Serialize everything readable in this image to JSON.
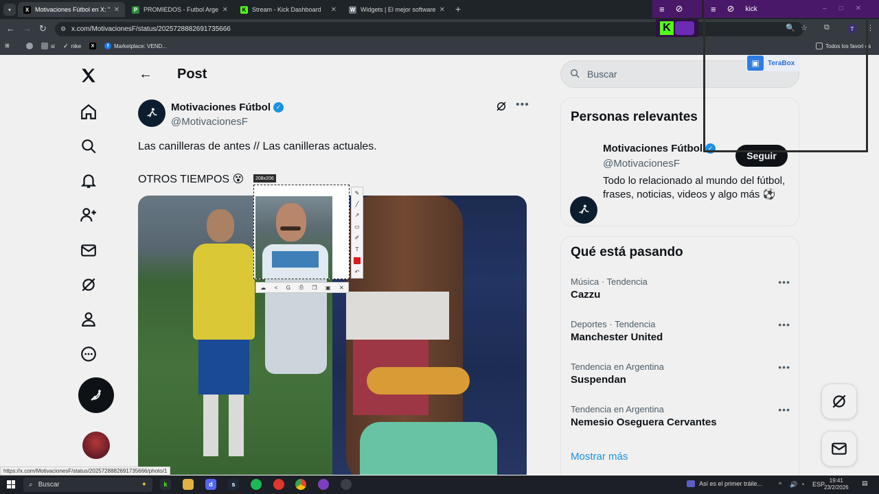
{
  "browser": {
    "tabs": [
      {
        "title": "Motivaciones Fútbol en X: \"Las",
        "favicon": "X",
        "active": true
      },
      {
        "title": "PROMIEDOS - Futbol Argentino",
        "favicon": "P",
        "active": false
      },
      {
        "title": "Stream - Kick Dashboard",
        "favicon": "K",
        "active": false
      },
      {
        "title": "Widgets | El mejor software pa",
        "favicon": "W",
        "active": false
      }
    ],
    "url": "x.com/MotivacionesF/status/2025728882691735666",
    "bookmarks": [
      {
        "label": "si"
      },
      {
        "label": "nike"
      },
      {
        "label": ""
      },
      {
        "label": "Marketplace: VEND..."
      }
    ],
    "all_favorites": "Todos los favori os"
  },
  "overlay": {
    "kick_window_title": "kick",
    "terabox_label": "TeraBox"
  },
  "page": {
    "header_title": "Post",
    "author": {
      "name": "Motivaciones Fútbol",
      "handle": "@MotivacionesF"
    },
    "tweet_line1": "Las canilleras de antes // Las canilleras actuales.",
    "tweet_line2": "OTROS TIEMPOS 😵",
    "capture_size": "208x206"
  },
  "sidebar_right": {
    "search_placeholder": "Buscar",
    "relevant_title": "Personas relevantes",
    "relevant": {
      "name": "Motivaciones Fútbol",
      "handle": "@MotivacionesF",
      "follow_label": "Seguir",
      "bio": "Todo lo relacionado al mundo del fútbol, frases, noticias, videos y algo más ⚽"
    },
    "trends_title": "Qué está pasando",
    "trends": [
      {
        "meta": "Música · Tendencia",
        "name": "Cazzu"
      },
      {
        "meta": "Deportes · Tendencia",
        "name": "Manchester United"
      },
      {
        "meta": "Tendencia en Argentina",
        "name": "Suspendan"
      },
      {
        "meta": "Tendencia en Argentina",
        "name": "Nemesio Oseguera Cervantes"
      }
    ],
    "show_more": "Mostrar más"
  },
  "status_link": "https://x.com/MotivacionesF/status/2025728882691735666/photo/1",
  "taskbar": {
    "search_placeholder": "Buscar",
    "news": "Así es el primer tráile...",
    "lang": "ESP",
    "time": "19:41",
    "date": "23/2/2026"
  }
}
